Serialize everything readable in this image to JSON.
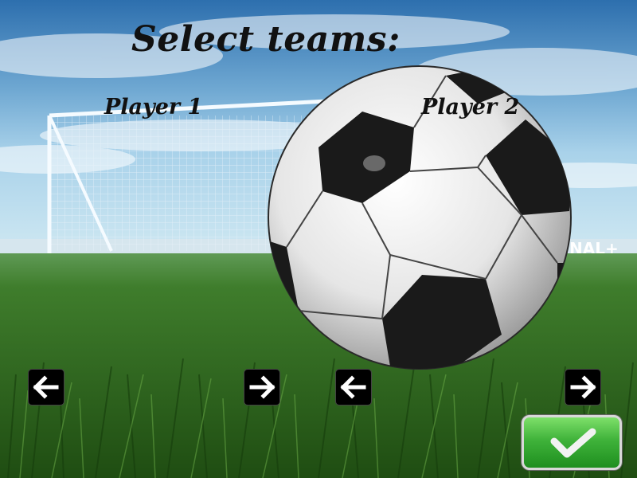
{
  "screen": {
    "title": "Select teams:",
    "player1_label": "Player 1",
    "player2_label": "Player 2"
  },
  "background": {
    "banner_right_text": "NAL+"
  },
  "controls": {
    "player1_prev": "left-arrow-icon",
    "player1_next": "right-arrow-icon",
    "player2_prev": "left-arrow-icon",
    "player2_next": "right-arrow-icon",
    "confirm": "checkmark-icon"
  },
  "colors": {
    "sky_top": "#2a6aa8",
    "grass": "#2f6a1e",
    "button_bg": "#000000",
    "confirm_green": "#3fb23a"
  }
}
